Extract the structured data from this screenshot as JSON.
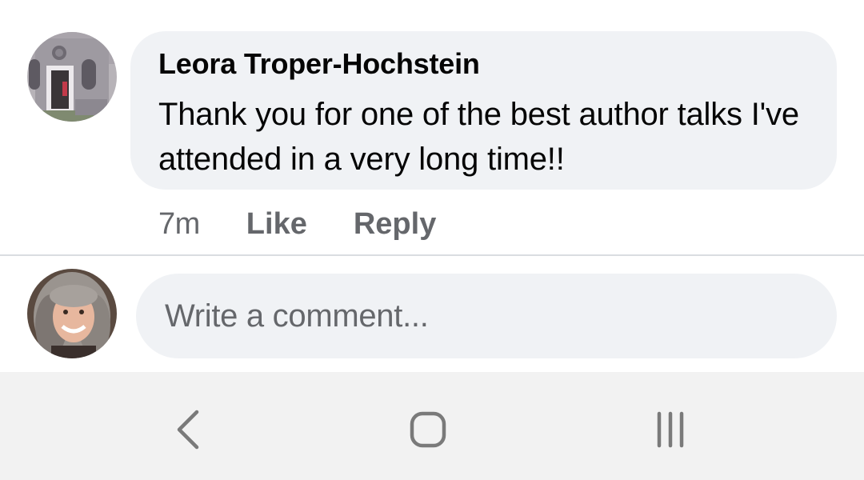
{
  "comment": {
    "author": "Leora Troper-Hochstein",
    "text": "Thank you for one of the best author talks I've attended in a very long time!!",
    "timestamp": "7m",
    "like_label": "Like",
    "reply_label": "Reply"
  },
  "composer": {
    "placeholder": "Write a comment..."
  },
  "navbar": {
    "back_icon": "back-icon",
    "home_icon": "home-icon",
    "recents_icon": "recents-icon"
  },
  "colors": {
    "bubble": "#f0f2f5",
    "secondary_text": "#65676b",
    "primary_text": "#050505",
    "navbar_bg": "#f2f2f2"
  }
}
